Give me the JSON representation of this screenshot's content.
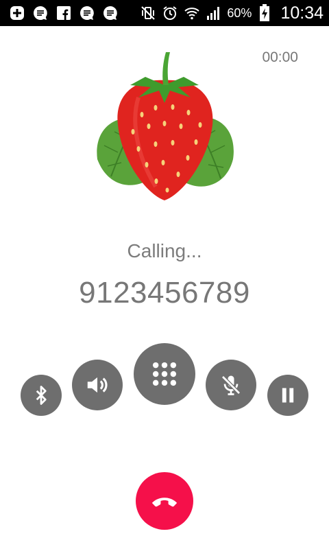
{
  "status_bar": {
    "battery_percent": "60%",
    "time": "10:34",
    "notification_icons": [
      "add-icon",
      "message-icon",
      "facebook-icon",
      "message-icon",
      "message-icon"
    ],
    "system_icons": [
      "vibrate-off-icon",
      "alarm-icon",
      "wifi-icon",
      "signal-icon",
      "battery-charging-icon"
    ]
  },
  "call": {
    "timer": "00:00",
    "status": "Calling...",
    "number": "9123456789"
  },
  "controls": {
    "icons": [
      "bluetooth-icon",
      "speaker-icon",
      "dialpad-icon",
      "mute-mic-icon",
      "pause-icon",
      "end-call-icon"
    ]
  },
  "colors": {
    "status_bar_bg": "#000000",
    "button_gray": "#6e6e6e",
    "end_call_red": "#f5104a",
    "text_gray": "#777777"
  }
}
